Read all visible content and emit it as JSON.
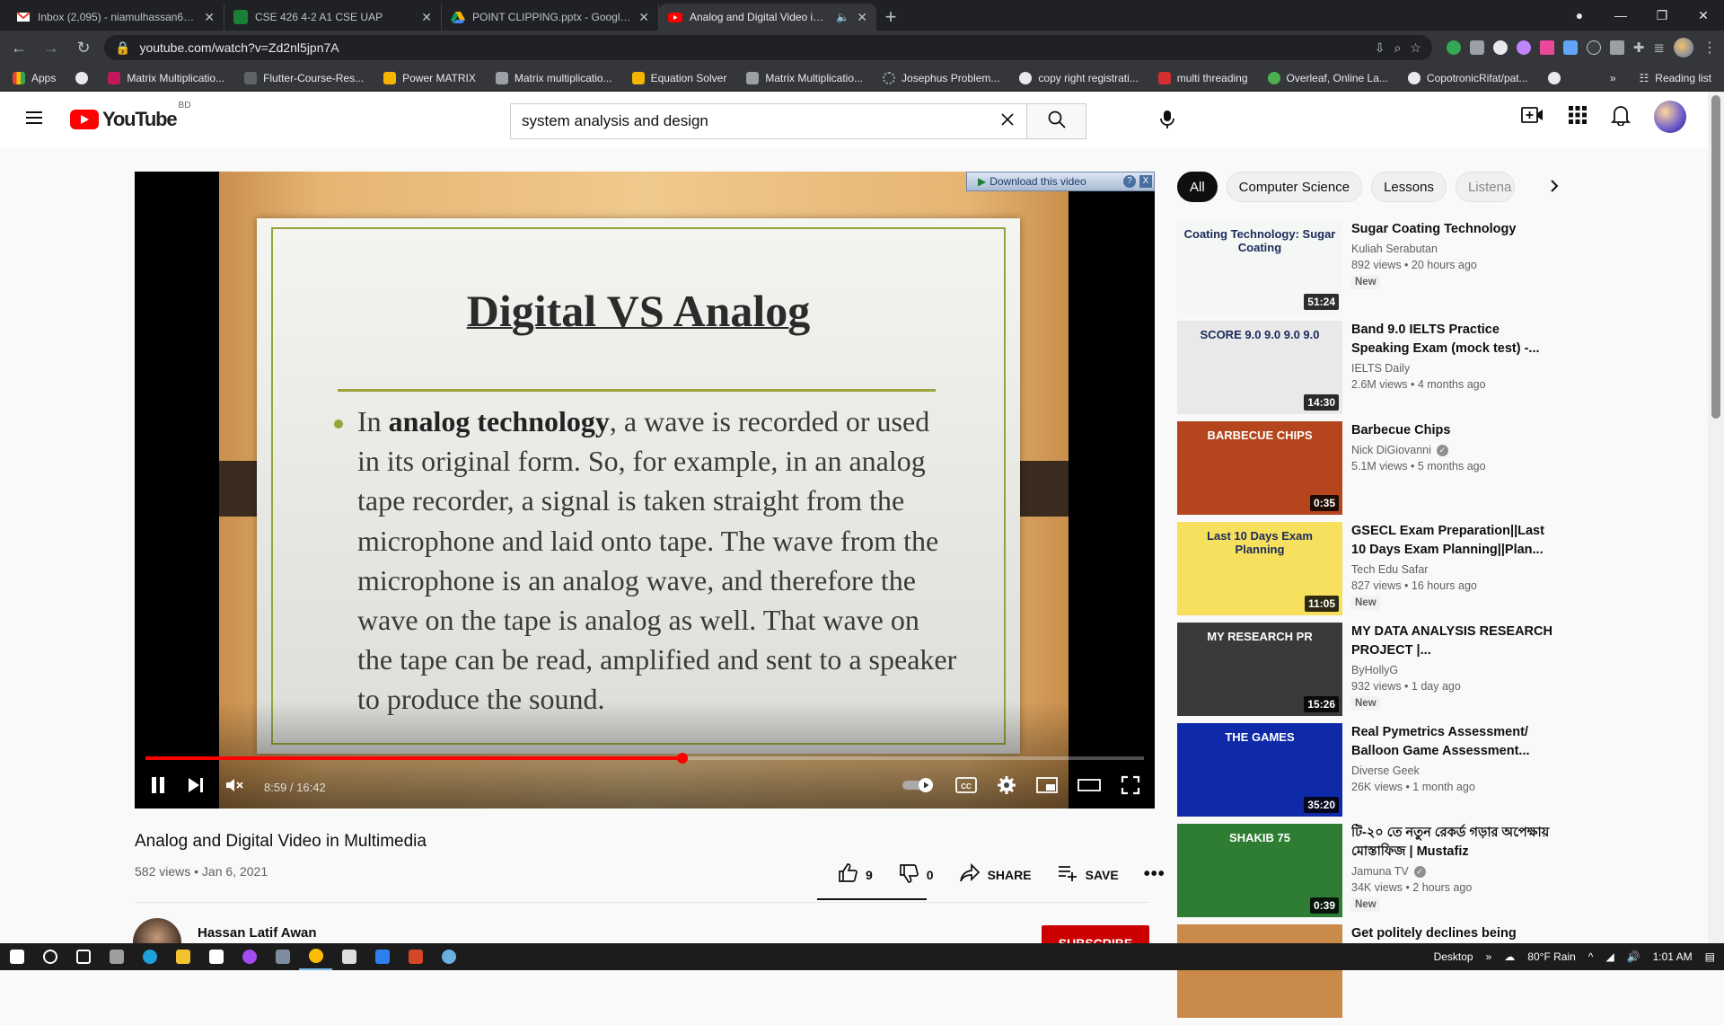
{
  "browser": {
    "tabs": [
      {
        "title": "Inbox (2,095) - niamulhassan64@",
        "favicon_color": "#ea4335",
        "active": false
      },
      {
        "title": "CSE 426 4-2 A1 CSE UAP",
        "favicon_color": "#188038",
        "active": false
      },
      {
        "title": "POINT CLIPPING.pptx - Google D",
        "favicon_color": "#f4b400",
        "active": false
      },
      {
        "title": "Analog and Digital Video in M",
        "favicon_color": "#ff0000",
        "active": true
      }
    ],
    "url": "youtube.com/watch?v=Zd2nl5jpn7A",
    "bookmarks": [
      {
        "label": "Apps",
        "color": "#ea4335"
      },
      {
        "label": "",
        "color": "#e8eaed"
      },
      {
        "label": "Matrix Multiplicatio...",
        "color": "#c2185b"
      },
      {
        "label": "Flutter-Course-Res...",
        "color": "#5f6368"
      },
      {
        "label": "Power MATRIX",
        "color": "#f4b400"
      },
      {
        "label": "Matrix multiplicatio...",
        "color": "#9aa0a6"
      },
      {
        "label": "Equation Solver",
        "color": "#f4b400"
      },
      {
        "label": "Matrix Multiplicatio...",
        "color": "#9aa0a6"
      },
      {
        "label": "Josephus Problem...",
        "color": "#5f6368"
      },
      {
        "label": "copy right registrati...",
        "color": "#e8eaed"
      },
      {
        "label": "multi threading",
        "color": "#d32f2f"
      },
      {
        "label": "Overleaf, Online La...",
        "color": "#4caf50"
      },
      {
        "label": "CopotronicRifat/pat...",
        "color": "#e8eaed"
      },
      {
        "label": "",
        "color": "#e8eaed"
      }
    ],
    "overflow": "»",
    "reading_list": "Reading list"
  },
  "youtube": {
    "logo_text": "YouTube",
    "country_code": "BD",
    "search_query": "system analysis and design"
  },
  "player": {
    "download_banner": "Download this video",
    "banner_help": "?",
    "banner_close": "X",
    "slide": {
      "title": "Digital VS Analog",
      "body_pre": "In ",
      "body_bold": "analog technology",
      "body_rest": ", a wave is recorded or used in its original form. So, for example, in an analog tape recorder, a signal is taken straight from the microphone and laid onto tape. The wave from the microphone is an analog wave, and therefore the wave on the tape is analog as well. That wave on the tape can be read, amplified and sent to a speaker to produce the sound."
    },
    "current_time": "8:59",
    "duration": "16:42",
    "timecode": "8:59 / 16:42",
    "progress_fraction": 0.538
  },
  "video": {
    "title": "Analog and Digital Video in Multimedia",
    "stats": "582 views • Jan 6, 2021",
    "likes": "9",
    "dislikes": "0",
    "share_label": "SHARE",
    "save_label": "SAVE",
    "channel_name": "Hassan Latif Awan",
    "subscribe_label": "SUBSCRIBE"
  },
  "chips": [
    "All",
    "Computer Science",
    "Lessons",
    "Listena"
  ],
  "recommendations": [
    {
      "title": "Sugar Coating Technology",
      "channel": "Kuliah Serabutan",
      "meta": "892 views • 20 hours ago",
      "badge": "New",
      "duration": "51:24",
      "verified": false,
      "thumb_text": "Coating Technology: Sugar Coating",
      "thumb_bg": "#f4f7f4"
    },
    {
      "title": "Band 9.0 IELTS Practice Speaking Exam (mock test) -...",
      "channel": "IELTS Daily",
      "meta": "2.6M views • 4 months ago",
      "badge": "",
      "duration": "14:30",
      "verified": false,
      "thumb_text": "SCORE 9.0 9.0 9.0 9.0",
      "thumb_bg": "#e9e9e9"
    },
    {
      "title": "Barbecue Chips",
      "channel": "Nick DiGiovanni",
      "meta": "5.1M views • 5 months ago",
      "badge": "",
      "duration": "0:35",
      "verified": true,
      "thumb_text": "BARBECUE CHIPS",
      "thumb_bg": "#b5451c"
    },
    {
      "title": "GSECL Exam Preparation||Last 10 Days Exam Planning||Plan...",
      "channel": "Tech Edu Safar",
      "meta": "827 views • 16 hours ago",
      "badge": "New",
      "duration": "11:05",
      "verified": false,
      "thumb_text": "Last 10 Days Exam Planning",
      "thumb_bg": "#f6e05e"
    },
    {
      "title": "MY DATA ANALYSIS RESEARCH PROJECT |...",
      "channel": "ByHollyG",
      "meta": "932 views • 1 day ago",
      "badge": "New",
      "duration": "15:26",
      "verified": false,
      "thumb_text": "MY RESEARCH PR",
      "thumb_bg": "#3a3a3a"
    },
    {
      "title": "Real Pymetrics Assessment/ Balloon Game Assessment...",
      "channel": "Diverse Geek",
      "meta": "26K views • 1 month ago",
      "badge": "",
      "duration": "35:20",
      "verified": false,
      "thumb_text": "THE GAMES",
      "thumb_bg": "#0f2aa8"
    },
    {
      "title": "টি-২০ তে নতুন রেকর্ড গড়ার অপেক্ষায় মোস্তাফিজ | Mustafiz",
      "channel": "Jamuna TV",
      "meta": "34K views • 2 hours ago",
      "badge": "New",
      "duration": "0:39",
      "verified": true,
      "thumb_text": "SHAKIB 75",
      "thumb_bg": "#2e7d32"
    },
    {
      "title": "Get politely declines being",
      "channel": "",
      "meta": "",
      "badge": "",
      "duration": "",
      "verified": false,
      "thumb_text": "",
      "thumb_bg": "#c98a4a"
    }
  ],
  "taskbar": {
    "desktop_label": "Desktop",
    "weather": "80°F  Rain",
    "time": "1:01 AM",
    "apps": [
      {
        "name": "windows",
        "color": "#ffffff"
      },
      {
        "name": "search",
        "color": "#ffffff"
      },
      {
        "name": "task-view",
        "color": "#ffffff"
      },
      {
        "name": "terminal",
        "color": "#9e9e9e"
      },
      {
        "name": "edge",
        "color": "#1ea0db"
      },
      {
        "name": "file-explorer",
        "color": "#f4c430"
      },
      {
        "name": "mail",
        "color": "#ffffff"
      },
      {
        "name": "messenger",
        "color": "#a34cf0"
      },
      {
        "name": "app",
        "color": "#7d8d9e"
      },
      {
        "name": "chrome",
        "color": "#fbbc05"
      },
      {
        "name": "obs",
        "color": "#dddddd"
      },
      {
        "name": "vscode",
        "color": "#2f80ed"
      },
      {
        "name": "powerpoint",
        "color": "#d24726"
      },
      {
        "name": "app2",
        "color": "#6ab0de"
      }
    ]
  }
}
